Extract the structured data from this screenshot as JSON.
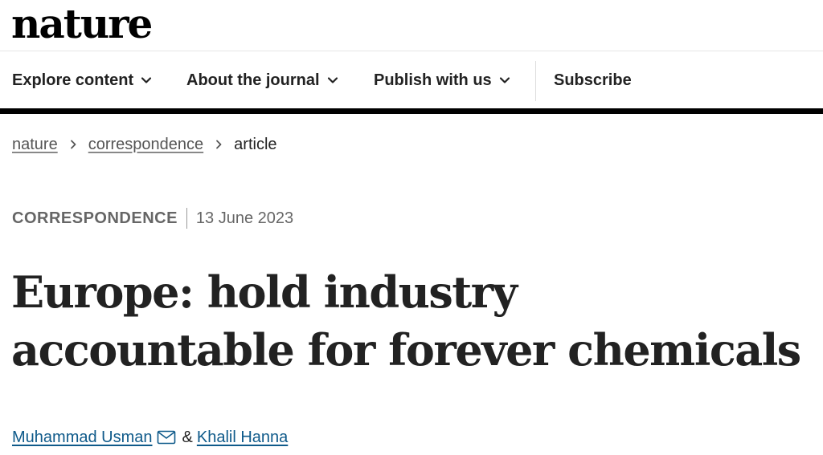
{
  "brand": {
    "logo_text": "nature"
  },
  "nav": {
    "items": [
      {
        "label": "Explore content",
        "icon": "chevron-down-icon"
      },
      {
        "label": "About the journal",
        "icon": "chevron-down-icon"
      },
      {
        "label": "Publish with us",
        "icon": "chevron-down-icon"
      }
    ],
    "subscribe_label": "Subscribe"
  },
  "breadcrumb": {
    "items": [
      "nature",
      "correspondence"
    ],
    "current": "article"
  },
  "article": {
    "type": "CORRESPONDENCE",
    "date": "13 June 2023",
    "title": "Europe: hold industry accountable for forever chemicals",
    "authors": [
      "Muhammad Usman",
      "Khalil Hanna"
    ],
    "author_separator": "&"
  },
  "colors": {
    "text": "#222222",
    "muted": "#666666",
    "link": "#0f5a8a",
    "rule": "#000000"
  }
}
